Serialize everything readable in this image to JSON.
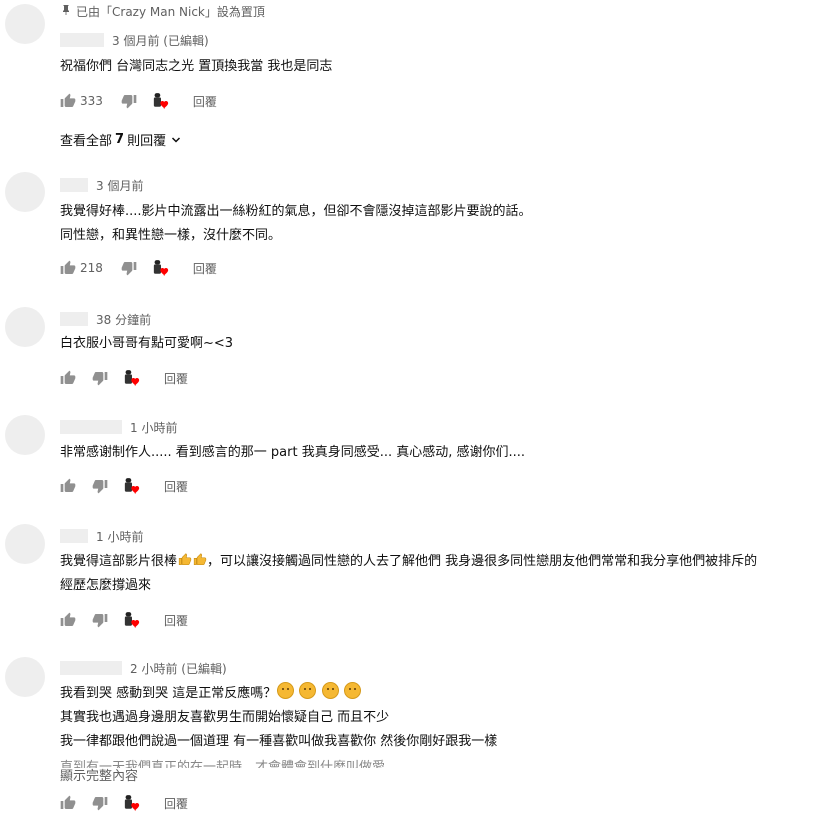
{
  "comments": [
    {
      "pinned_label": "已由「Crazy Man Nick」設為置頂",
      "time": "3 個月前 (已編輯)",
      "lines": [
        "祝福你們 台灣同志之光 置頂換我當 我也是同志"
      ],
      "likes": "333",
      "reply_label": "回覆",
      "view_replies": {
        "prefix": "查看全部",
        "count": "7",
        "suffix": "則回覆"
      }
    },
    {
      "time": "3 個月前",
      "lines": [
        "我覺得好棒....影片中流露出一絲粉紅的氣息，但卻不會隱沒掉這部影片要說的話。",
        "同性戀，和異性戀一樣，沒什麼不同。"
      ],
      "likes": "218",
      "reply_label": "回覆"
    },
    {
      "time": "38 分鐘前",
      "lines": [
        "白衣服小哥哥有點可愛啊~<3"
      ],
      "likes": "",
      "reply_label": "回覆"
    },
    {
      "time": "1 小時前",
      "lines": [
        "非常感谢制作人..... 看到感言的那一 part 我真身同感受... 真心感动, 感谢你们...."
      ],
      "likes": "",
      "reply_label": "回覆"
    },
    {
      "time": "1 小時前",
      "line1_pre": "我覺得這部影片很棒",
      "line1_post": "，可以讓沒接觸過同性戀的人去了解他們 我身邊很多同性戀朋友他們常常和我分享他們被排斥的",
      "lines": [
        "經歷怎麼撐過來"
      ],
      "likes": "",
      "reply_label": "回覆"
    },
    {
      "time": "2 小時前 (已編輯)",
      "line1": "我看到哭 感動到哭 這是正常反應嗎？",
      "lines": [
        "其實我也遇過身邊朋友喜歡男生而開始懷疑自己 而且不少",
        "我一律都跟他們說過一個道理 有一種喜歡叫做我喜歡你 然後你剛好跟我一樣"
      ],
      "fade_line": "直到有一天我們真正的在一起時，才會體會到什麼叫做愛",
      "show_more": "顯示完整內容",
      "likes": "",
      "reply_label": "回覆"
    }
  ],
  "icons": {
    "like": "thumbs-up-icon",
    "dislike": "thumbs-down-icon",
    "creator_heart": "creator-heart-icon",
    "pin": "pin-icon",
    "chevron": "chevron-down-icon"
  },
  "colors": {
    "heart": "#ff0000",
    "secondary_text": "#606060",
    "placeholder": "#eeeeee"
  }
}
